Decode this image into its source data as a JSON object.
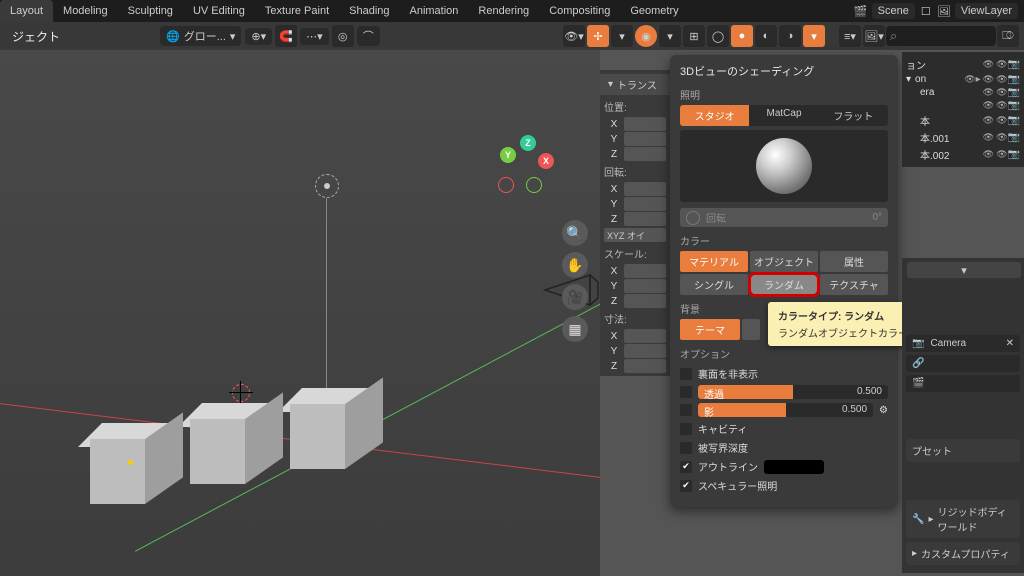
{
  "tabs": {
    "layout": "Layout",
    "modeling": "Modeling",
    "sculpting": "Sculpting",
    "uv": "UV Editing",
    "texpaint": "Texture Paint",
    "shading": "Shading",
    "anim": "Animation",
    "render": "Rendering",
    "comp": "Compositing",
    "geo": "Geometry"
  },
  "scene": {
    "name": "Scene",
    "layer": "ViewLayer"
  },
  "toolbar": {
    "jekuto": "ジェクト",
    "global": "グロー..."
  },
  "npanel": {
    "header": "トランス",
    "pos": "位置:",
    "rot": "回転:",
    "xyz": "XYZ オイ",
    "scale": "スケール:",
    "dim": "寸法:",
    "x": "X",
    "y": "Y",
    "z": "Z"
  },
  "pop": {
    "title": "3Dビューのシェーディング",
    "lighting": "照明",
    "studio": "スタジオ",
    "matcap": "MatCap",
    "flat": "フラット",
    "rotation": "回転",
    "rot_val": "0°",
    "color": "カラー",
    "material": "マテリアル",
    "object": "オブジェクト",
    "attribute": "属性",
    "single": "シングル",
    "random": "ランダム",
    "texture": "テクスチャ",
    "background": "背景",
    "theme": "テーマ",
    "options": "オプション",
    "backface": "裏面を非表示",
    "xray": "透過",
    "xray_v": "0.500",
    "shadow": "影",
    "shadow_v": "0.500",
    "cavity": "キャビティ",
    "dof": "被写界深度",
    "outline": "アウトライン",
    "specular": "スペキュラー照明"
  },
  "tooltip": {
    "line1": "カラータイプ: ランダム",
    "line2": "ランダムオブジェクトカラーを表示します"
  },
  "outliner": {
    "r1": "ョン",
    "r2": "on",
    "r3": "era",
    "r4": "",
    "r5": "本",
    "r6": "本.001",
    "r7": "本.002"
  },
  "props": {
    "camera": "Camera",
    "preset": "プセット",
    "rigid": "リジッドボディワールド",
    "custom": "カスタムプロパティ"
  }
}
